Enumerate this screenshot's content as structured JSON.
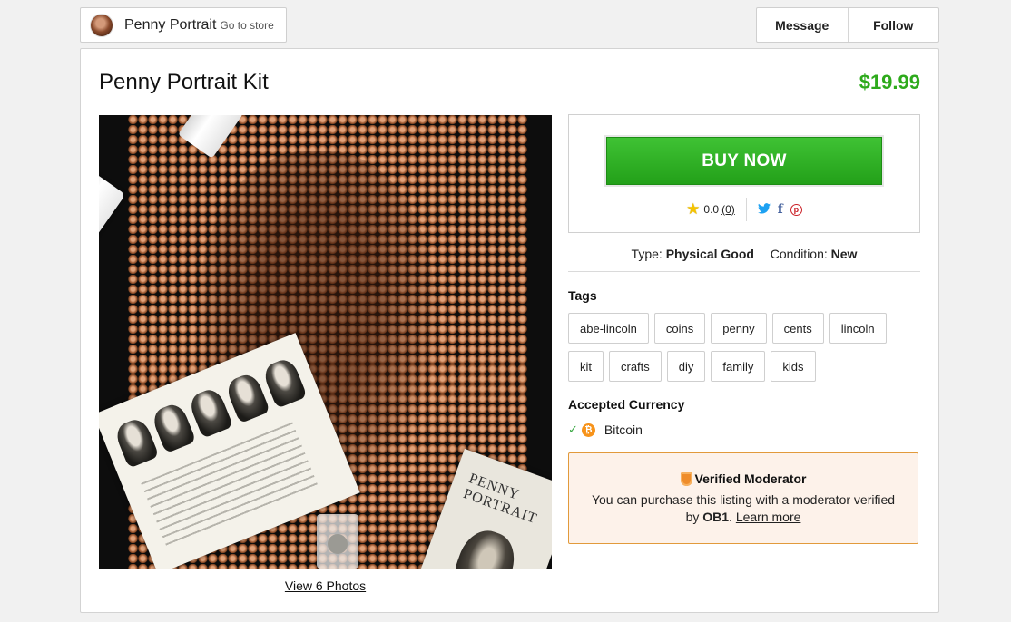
{
  "store": {
    "name": "Penny Portrait",
    "link_label": "Go to store"
  },
  "actions": {
    "message_label": "Message",
    "follow_label": "Follow"
  },
  "listing": {
    "title": "Penny Portrait Kit",
    "price": "$19.99",
    "price_color": "#2eaa1c",
    "view_photos_label": "View 6 Photos",
    "photo_booklet_text": "PENNY PORTRAIT"
  },
  "buy": {
    "button_label": "BUY NOW",
    "button_color": "#2aa61f",
    "rating": "0.0",
    "rating_count": "(0)",
    "icons": [
      "star-icon",
      "twitter-icon",
      "facebook-icon",
      "pinterest-icon"
    ]
  },
  "details": {
    "type_label": "Type:",
    "type_value": "Physical Good",
    "condition_label": "Condition:",
    "condition_value": "New"
  },
  "tags": {
    "heading": "Tags",
    "items": [
      "abe-lincoln",
      "coins",
      "penny",
      "cents",
      "lincoln",
      "kit",
      "crafts",
      "diy",
      "family",
      "kids"
    ]
  },
  "currency": {
    "heading": "Accepted Currency",
    "items": [
      "Bitcoin"
    ],
    "bitcoin_color": "#f7931a"
  },
  "moderator": {
    "title": "Verified Moderator",
    "text_before": "You can purchase this listing with a moderator verified by",
    "org": "OB1",
    "text_after": ".",
    "learn_more": "Learn more",
    "border_color": "#e29a3b",
    "background_color": "#fdf2ea"
  }
}
